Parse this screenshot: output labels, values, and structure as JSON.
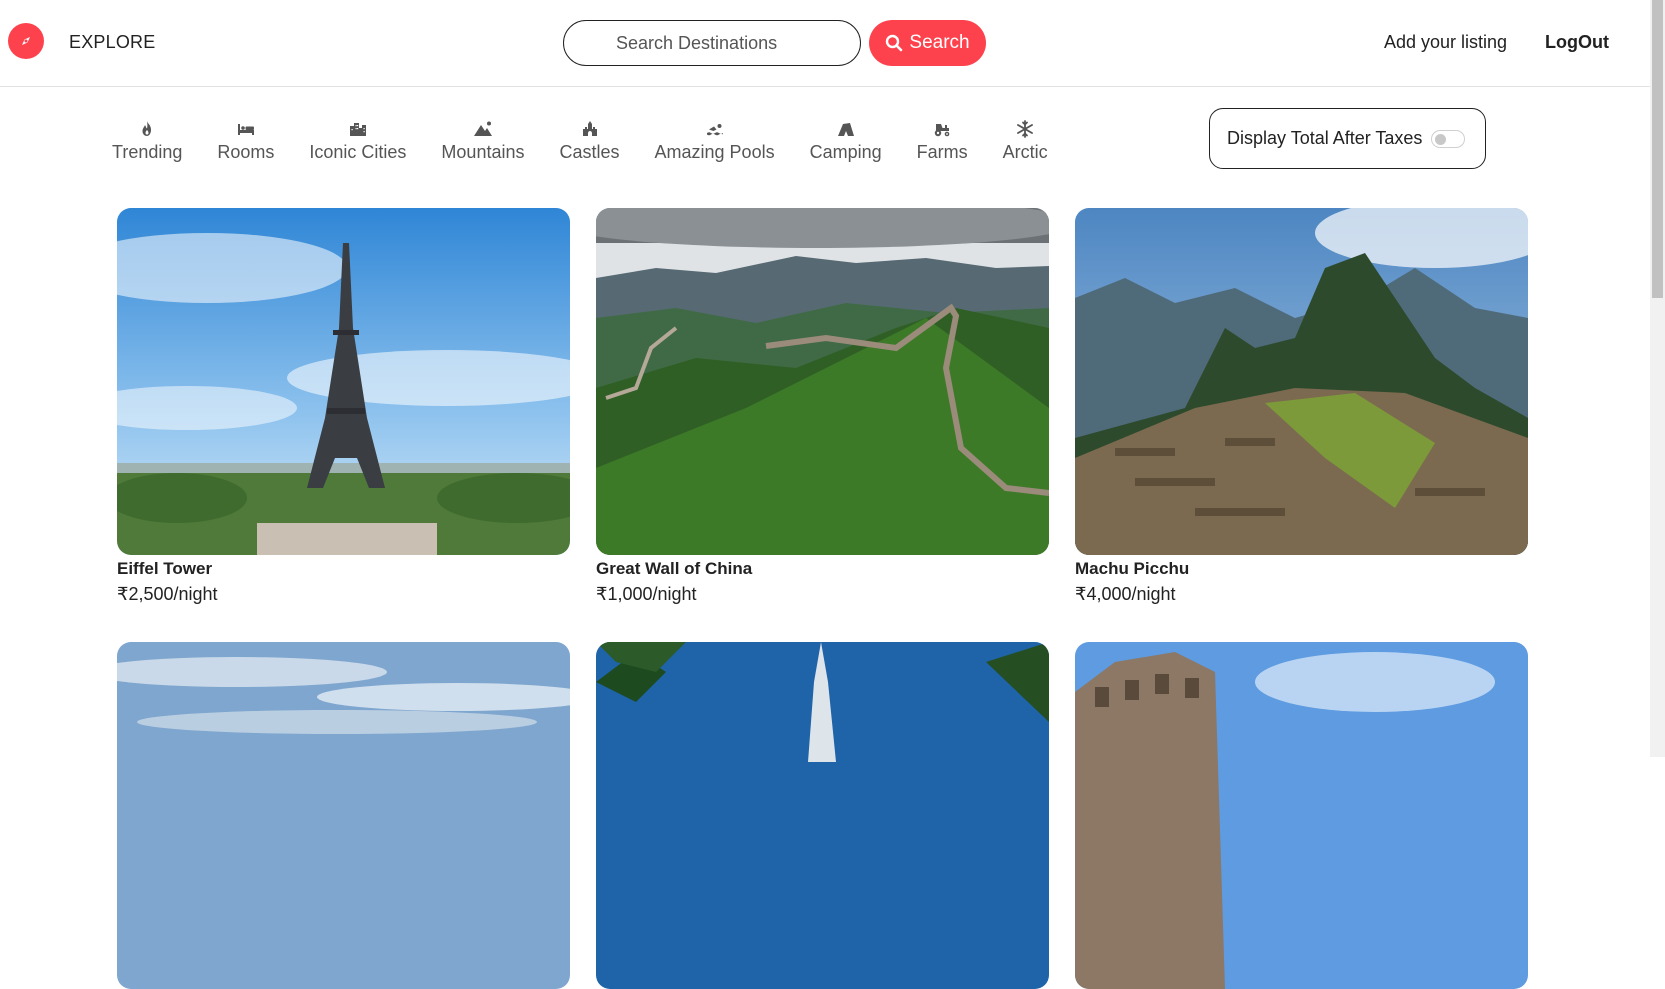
{
  "navbar": {
    "brand": "EXPLORE",
    "search_placeholder": "Search Destinations",
    "search_button": "Search",
    "add_listing": "Add your listing",
    "logout": "LogOut",
    "accent": "#fe424d"
  },
  "filters": [
    {
      "label": "Trending",
      "icon": "fire-icon"
    },
    {
      "label": "Rooms",
      "icon": "bed-icon"
    },
    {
      "label": "Iconic Cities",
      "icon": "city-icon"
    },
    {
      "label": "Mountains",
      "icon": "mountain-icon"
    },
    {
      "label": "Castles",
      "icon": "castle-icon"
    },
    {
      "label": "Amazing Pools",
      "icon": "swimmer-icon"
    },
    {
      "label": "Camping",
      "icon": "tent-icon"
    },
    {
      "label": "Farms",
      "icon": "tractor-icon"
    },
    {
      "label": "Arctic",
      "icon": "snowflake-icon"
    }
  ],
  "tax_toggle": {
    "label": "Display Total After Taxes",
    "enabled": false
  },
  "listings": [
    {
      "title": "Eiffel Tower",
      "price": "₹2,500/night"
    },
    {
      "title": "Great Wall of China",
      "price": "₹1,000/night"
    },
    {
      "title": "Machu Picchu",
      "price": "₹4,000/night"
    }
  ]
}
